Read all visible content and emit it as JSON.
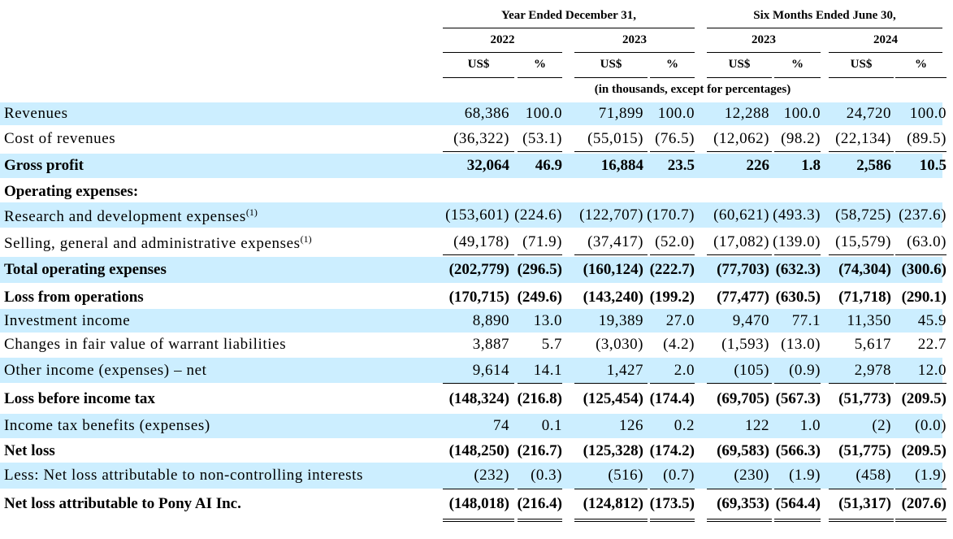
{
  "header": {
    "period_groups": [
      "Year Ended December 31,",
      "Six Months Ended June 30,"
    ],
    "years": [
      "2022",
      "2023",
      "2023",
      "2024"
    ],
    "col_labels": [
      "US$",
      "%",
      "US$",
      "%",
      "US$",
      "%",
      "US$",
      "%"
    ],
    "units_note": "(in thousands, except for percentages)"
  },
  "rows": [
    {
      "label": "Revenues",
      "bold": false,
      "shaded": true,
      "values": [
        "68,386",
        "100.0",
        "71,899",
        "100.0",
        "12,288",
        "100.0",
        "24,720",
        "100.0"
      ]
    },
    {
      "label": "Cost of revenues",
      "bold": false,
      "shaded": false,
      "values": [
        "(36,322)",
        "(53.1)",
        "(55,015)",
        "(76.5)",
        "(12,062)",
        "(98.2)",
        "(22,134)",
        "(89.5)"
      ]
    },
    {
      "label": "Gross profit",
      "bold": true,
      "shaded": true,
      "values": [
        "32,064",
        "46.9",
        "16,884",
        "23.5",
        "226",
        "1.8",
        "2,586",
        "10.5"
      ]
    },
    {
      "label": "Operating expenses:",
      "bold": true,
      "shaded": false,
      "values": [
        "",
        "",
        "",
        "",
        "",
        "",
        "",
        ""
      ]
    },
    {
      "label": "Research and development expenses",
      "footnote": "(1)",
      "bold": false,
      "shaded": true,
      "values": [
        "(153,601)",
        "(224.6)",
        "(122,707)",
        "(170.7)",
        "(60,621)",
        "(493.3)",
        "(58,725)",
        "(237.6)"
      ]
    },
    {
      "label": "Selling, general and administrative expenses",
      "footnote": "(1)",
      "bold": false,
      "shaded": false,
      "values": [
        "(49,178)",
        "(71.9)",
        "(37,417)",
        "(52.0)",
        "(17,082)",
        "(139.0)",
        "(15,579)",
        "(63.0)"
      ]
    },
    {
      "label": "Total operating expenses",
      "bold": true,
      "shaded": true,
      "values": [
        "(202,779)",
        "(296.5)",
        "(160,124)",
        "(222.7)",
        "(77,703)",
        "(632.3)",
        "(74,304)",
        "(300.6)"
      ]
    },
    {
      "label": "Loss from operations",
      "bold": true,
      "shaded": false,
      "values": [
        "(170,715)",
        "(249.6)",
        "(143,240)",
        "(199.2)",
        "(77,477)",
        "(630.5)",
        "(71,718)",
        "(290.1)"
      ]
    },
    {
      "label": "Investment income",
      "bold": false,
      "shaded": true,
      "values": [
        "8,890",
        "13.0",
        "19,389",
        "27.0",
        "9,470",
        "77.1",
        "11,350",
        "45.9"
      ]
    },
    {
      "label": "Changes in fair value of warrant liabilities",
      "bold": false,
      "shaded": false,
      "values": [
        "3,887",
        "5.7",
        "(3,030)",
        "(4.2)",
        "(1,593)",
        "(13.0)",
        "5,617",
        "22.7"
      ]
    },
    {
      "label": "Other income (expenses) – net",
      "bold": false,
      "shaded": true,
      "values": [
        "9,614",
        "14.1",
        "1,427",
        "2.0",
        "(105)",
        "(0.9)",
        "2,978",
        "12.0"
      ]
    },
    {
      "label": "Loss before income tax",
      "bold": true,
      "shaded": false,
      "values": [
        "(148,324)",
        "(216.8)",
        "(125,454)",
        "(174.4)",
        "(69,705)",
        "(567.3)",
        "(51,773)",
        "(209.5)"
      ]
    },
    {
      "label": "Income tax benefits (expenses)",
      "bold": false,
      "shaded": true,
      "values": [
        "74",
        "0.1",
        "126",
        "0.2",
        "122",
        "1.0",
        "(2)",
        "(0.0)"
      ]
    },
    {
      "label": "Net loss",
      "bold": true,
      "shaded": false,
      "values": [
        "(148,250)",
        "(216.7)",
        "(125,328)",
        "(174.2)",
        "(69,583)",
        "(566.3)",
        "(51,775)",
        "(209.5)"
      ]
    },
    {
      "label": "Less: Net loss attributable to non-controlling interests",
      "bold": false,
      "shaded": true,
      "values": [
        "(232)",
        "(0.3)",
        "(516)",
        "(0.7)",
        "(230)",
        "(1.9)",
        "(458)",
        "(1.9)"
      ]
    },
    {
      "label": "Net loss attributable to Pony AI Inc.",
      "bold": true,
      "shaded": false,
      "values": [
        "(148,018)",
        "(216.4)",
        "(124,812)",
        "(173.5)",
        "(69,353)",
        "(564.4)",
        "(51,317)",
        "(207.6)"
      ]
    }
  ]
}
